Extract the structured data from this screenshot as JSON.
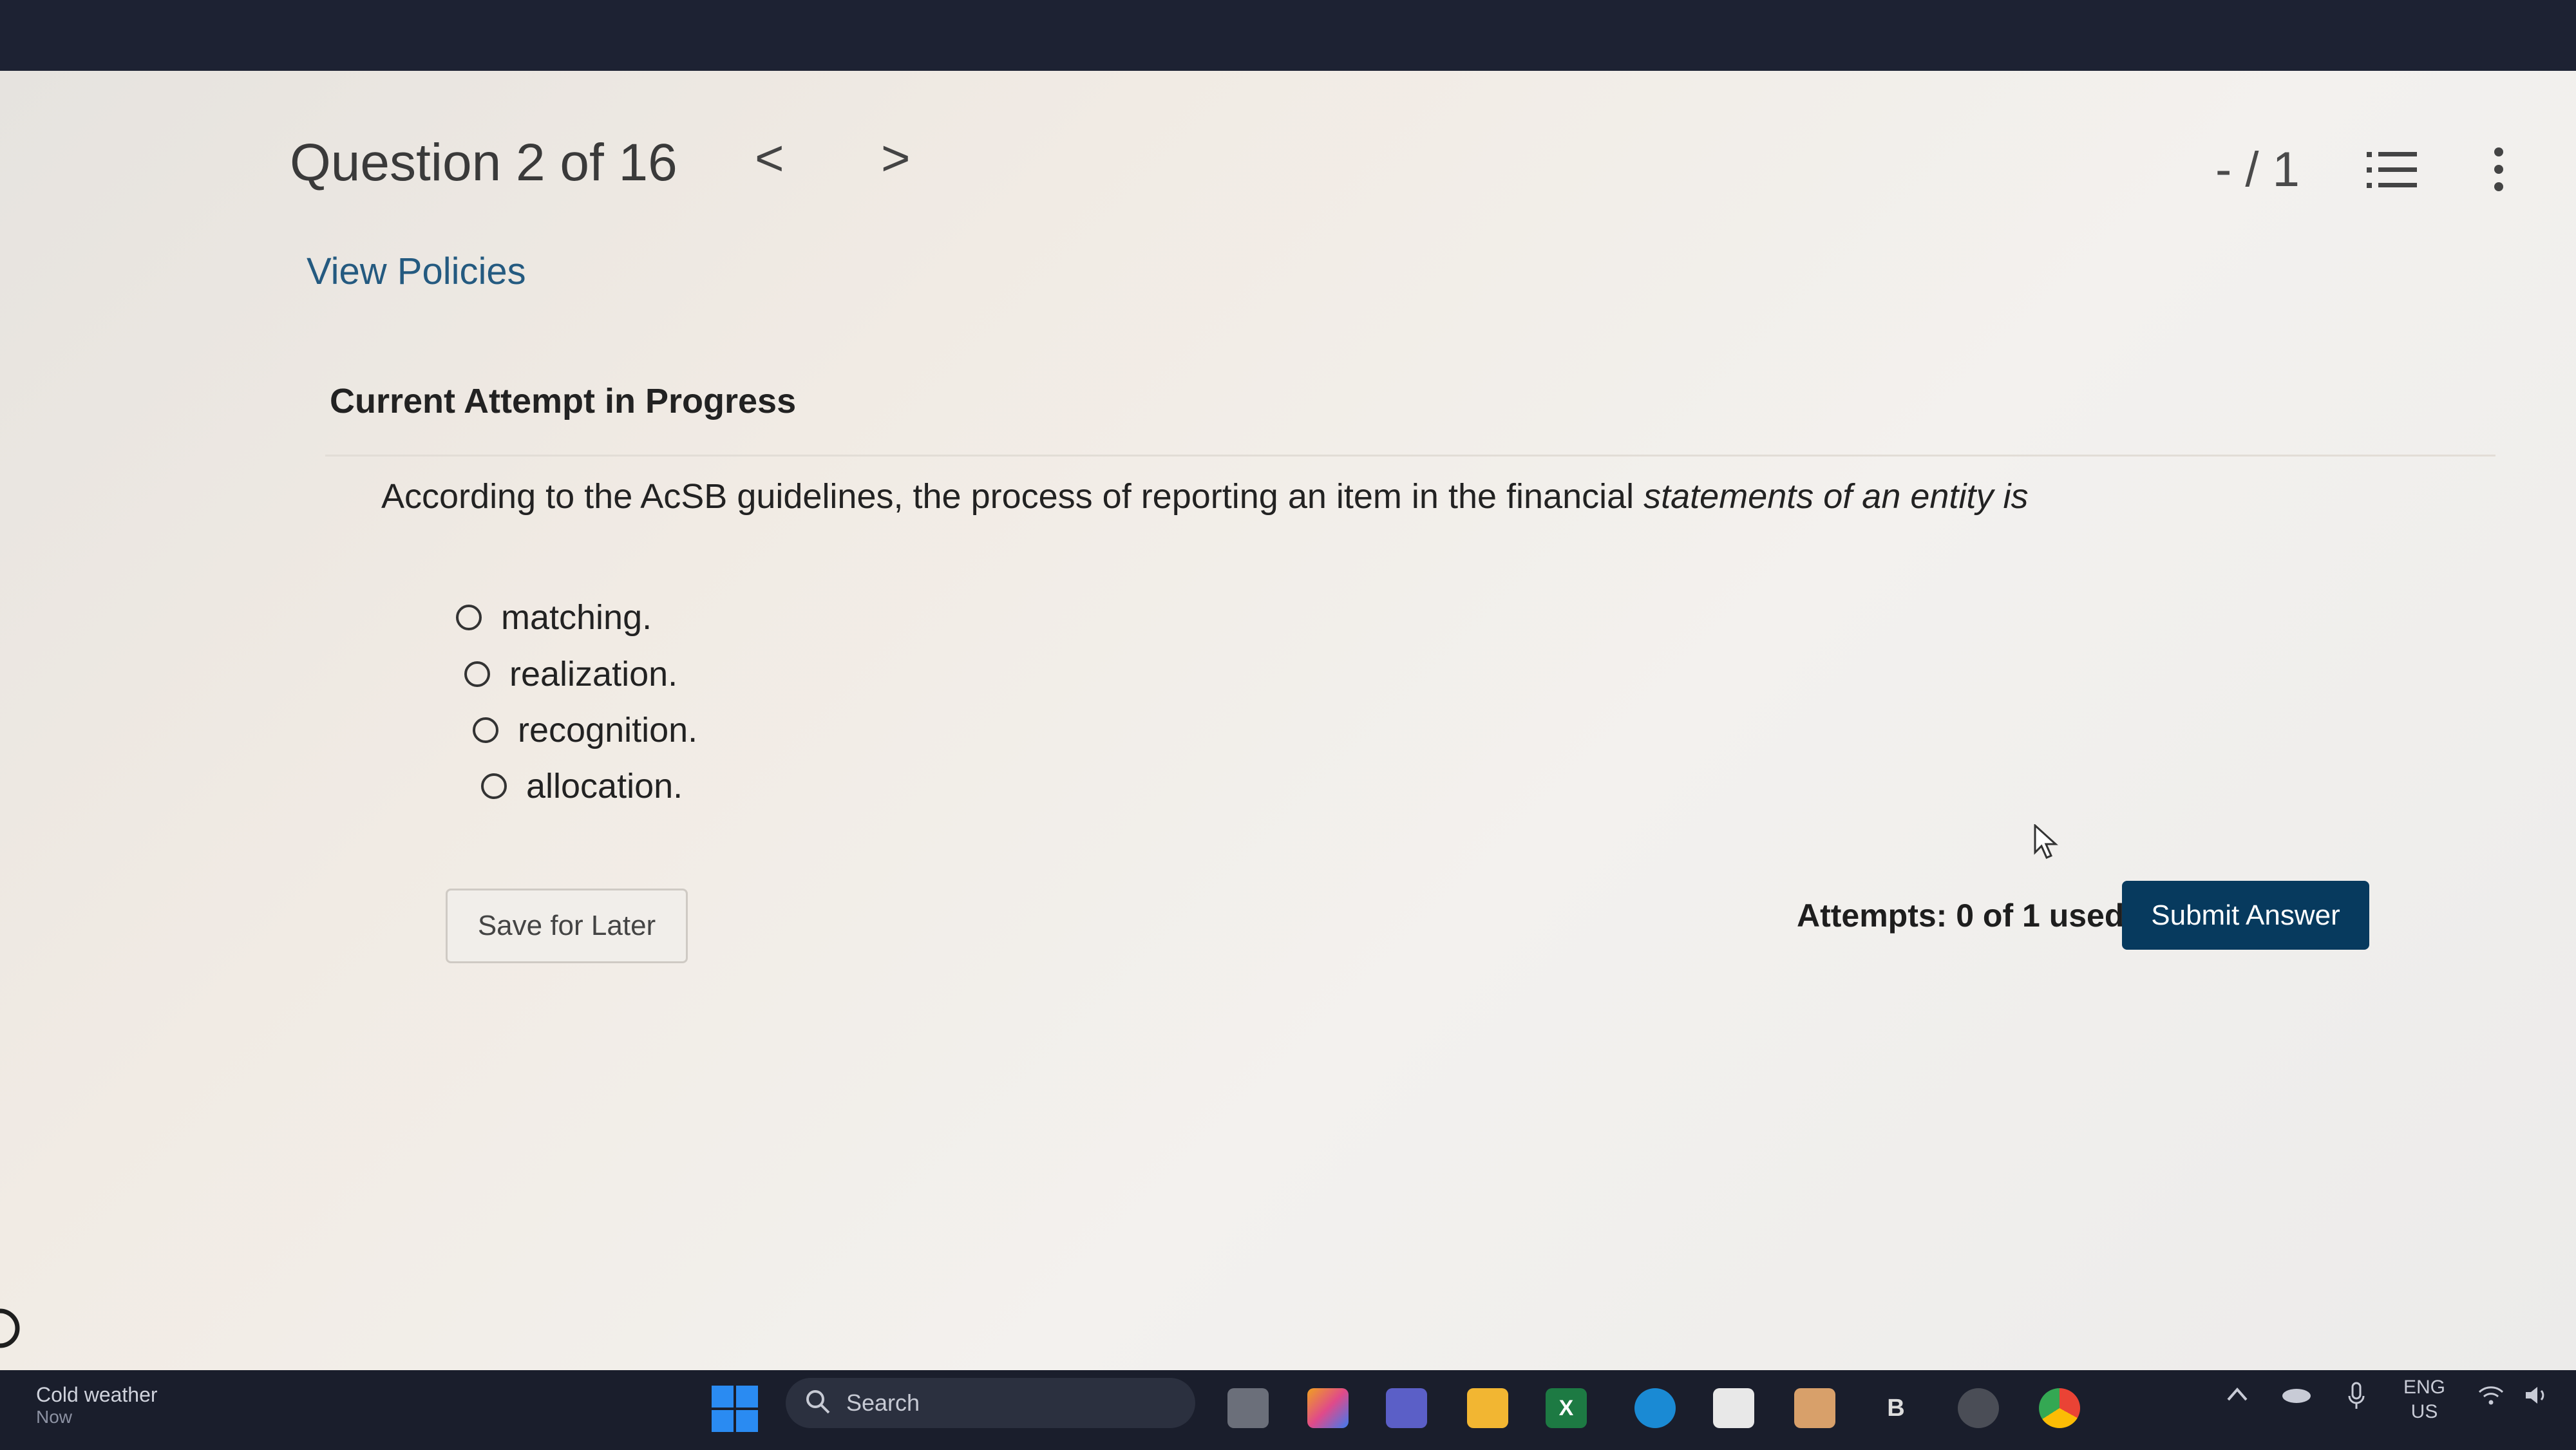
{
  "header": {
    "question_title": "Question 2 of 16",
    "prev_glyph": "<",
    "next_glyph": ">",
    "score": "- / 1"
  },
  "policies_link": "View Policies",
  "section_title": "Current Attempt in Progress",
  "question": {
    "text_plain": "According to the AcSB guidelines, the process of reporting an item in the financial",
    "text_italic": " statements of an entity is",
    "options": [
      "matching.",
      "realization.",
      "recognition.",
      "allocation."
    ]
  },
  "footer": {
    "save_label": "Save for Later",
    "attempts_label": "Attempts: 0 of 1 used",
    "submit_label": "Submit Answer"
  },
  "taskbar": {
    "weather_title": "Cold weather",
    "weather_sub": "Now",
    "search_label": "Search",
    "lang_top": "ENG",
    "lang_bottom": "US",
    "b_letter": "B",
    "x_letter": "X"
  },
  "colors": {
    "link": "#245a80",
    "submit_bg": "#073a5e",
    "taskbar_bg": "#1a1e2c"
  }
}
